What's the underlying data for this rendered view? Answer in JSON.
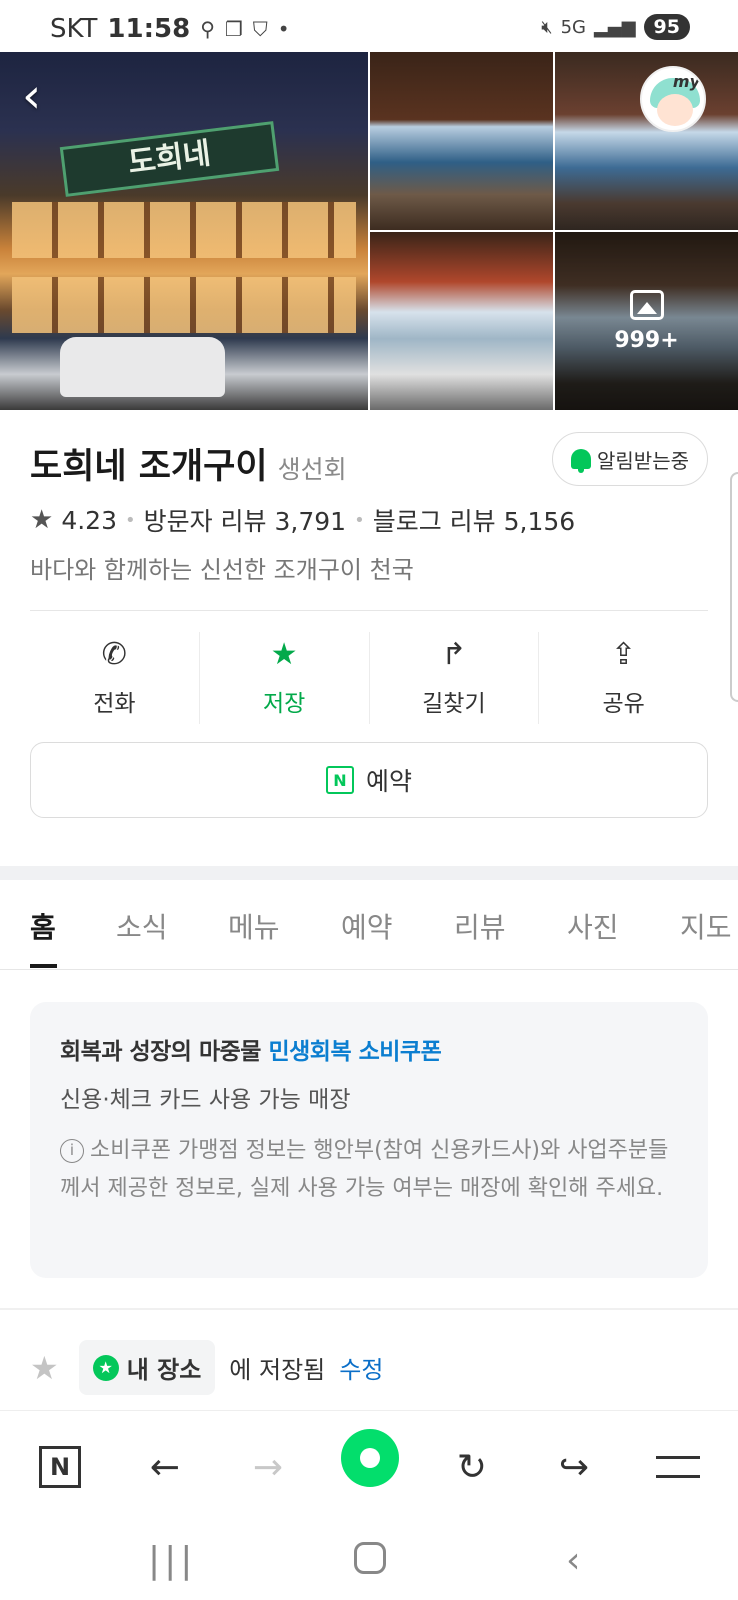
{
  "status_bar": {
    "carrier": "SKT",
    "time": "11:58",
    "network": "5G",
    "battery": "95"
  },
  "photos": {
    "count_label": "999+",
    "sign_text": "도희네",
    "avatar_label": "my"
  },
  "place": {
    "name": "도희네 조개구이",
    "category": "생선회",
    "notify_label": "알림받는중",
    "rating": "4.23",
    "visitor_reviews": "방문자 리뷰 3,791",
    "blog_reviews": "블로그 리뷰 5,156",
    "description": "바다와 함께하는 신선한 조개구이 천국"
  },
  "actions": [
    {
      "label": "전화",
      "icon": "phone-icon"
    },
    {
      "label": "저장",
      "icon": "star-icon"
    },
    {
      "label": "길찾기",
      "icon": "directions-icon"
    },
    {
      "label": "공유",
      "icon": "share-icon"
    }
  ],
  "reserve_label": "예약",
  "tabs": [
    "홈",
    "소식",
    "메뉴",
    "예약",
    "리뷰",
    "사진",
    "지도"
  ],
  "coupon": {
    "title_prefix": "회복과 성장의 마중물 ",
    "title_highlight": "민생회복 소비쿠폰",
    "subtitle": "신용·체크 카드 사용 가능 매장",
    "note": "소비쿠폰 가맹점 정보는 행안부(참여 신용카드사)와 사업주분들께서 제공한 정보로, 실제 사용 가능 여부는 매장에 확인해 주세요."
  },
  "saved": {
    "chip_label": "내 장소",
    "text": "에 저장됨",
    "edit_label": "수정"
  },
  "colors": {
    "accent_green": "#03c75a",
    "link_blue": "#0b7ed0"
  }
}
